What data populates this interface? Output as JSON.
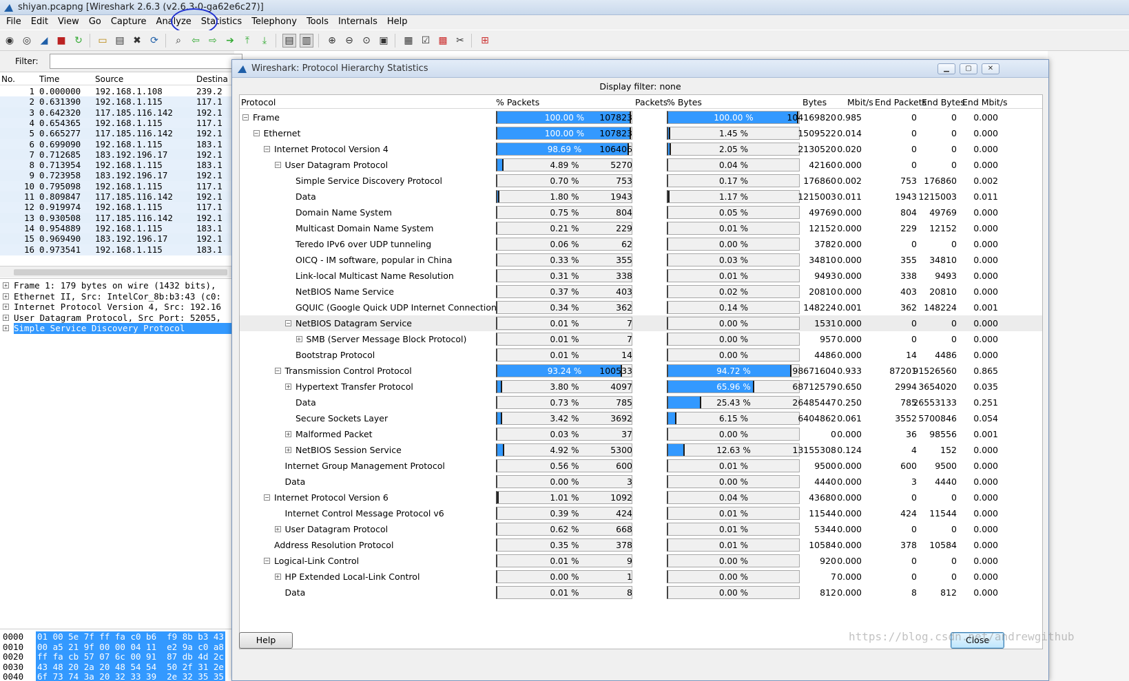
{
  "window": {
    "title": "shiyan.pcapng [Wireshark 2.6.3 (v2.6.3-0-ga62e6c27)]"
  },
  "menu": [
    "File",
    "Edit",
    "View",
    "Go",
    "Capture",
    "Analyze",
    "Statistics",
    "Telephony",
    "Tools",
    "Internals",
    "Help"
  ],
  "filter": {
    "label": "Filter:",
    "value": ""
  },
  "packet_list": {
    "columns": [
      "No.",
      "Time",
      "Source",
      "Destina"
    ],
    "rows": [
      [
        "1",
        "0.000000",
        "192.168.1.108",
        "239.2"
      ],
      [
        "2",
        "0.631390",
        "192.168.1.115",
        "117.1"
      ],
      [
        "3",
        "0.642320",
        "117.185.116.142",
        "192.1"
      ],
      [
        "4",
        "0.654365",
        "192.168.1.115",
        "117.1"
      ],
      [
        "5",
        "0.665277",
        "117.185.116.142",
        "192.1"
      ],
      [
        "6",
        "0.699090",
        "192.168.1.115",
        "183.1"
      ],
      [
        "7",
        "0.712685",
        "183.192.196.17",
        "192.1"
      ],
      [
        "8",
        "0.713954",
        "192.168.1.115",
        "183.1"
      ],
      [
        "9",
        "0.723958",
        "183.192.196.17",
        "192.1"
      ],
      [
        "10",
        "0.795098",
        "192.168.1.115",
        "117.1"
      ],
      [
        "11",
        "0.809847",
        "117.185.116.142",
        "192.1"
      ],
      [
        "12",
        "0.919974",
        "192.168.1.115",
        "117.1"
      ],
      [
        "13",
        "0.930508",
        "117.185.116.142",
        "192.1"
      ],
      [
        "14",
        "0.954889",
        "192.168.1.115",
        "183.1"
      ],
      [
        "15",
        "0.969490",
        "183.192.196.17",
        "192.1"
      ],
      [
        "16",
        "0.973541",
        "192.168.1.115",
        "183.1"
      ]
    ]
  },
  "details": [
    "Frame 1: 179 bytes on wire (1432 bits),",
    "Ethernet II, Src: IntelCor_8b:b3:43 (c0:",
    "Internet Protocol Version 4, Src: 192.16",
    "User Datagram Protocol, Src Port: 52055,",
    "Simple Service Discovery Protocol"
  ],
  "hex": [
    {
      "offset": "0000",
      "bytes": "01 00 5e 7f ff fa c0 b6  f9 8b b3 43"
    },
    {
      "offset": "0010",
      "bytes": "00 a5 21 9f 00 00 04 11  e2 9a c0 a8"
    },
    {
      "offset": "0020",
      "bytes": "ff fa cb 57 07 6c 00 91  87 db 4d 2c"
    },
    {
      "offset": "0030",
      "bytes": "43 48 20 2a 20 48 54 54  50 2f 31 2e"
    },
    {
      "offset": "0040",
      "bytes": "6f 73 74 3a 20 32 33 39  2e 32 35 35"
    }
  ],
  "dialog": {
    "title": "Wireshark: Protocol Hierarchy Statistics",
    "display_filter": "Display filter: none",
    "columns": [
      "Protocol",
      "% Packets",
      "Packets",
      "% Bytes",
      "Bytes",
      "Mbit/s",
      "End Packets",
      "End Bytes",
      "End Mbit/s"
    ],
    "help_label": "Help",
    "close_label": "Close",
    "rows": [
      {
        "name": "Frame",
        "level": 0,
        "exp": "minus",
        "pkt_pct": 100.0,
        "pkt_pct_label": "100.00 %",
        "packets": "107823",
        "byte_pct": 100.0,
        "byte_pct_label": "100.00 %",
        "bytes": "104169820",
        "mbit": "0.985",
        "end_packets": "0",
        "end_bytes": "0",
        "end_mbit": "0.000"
      },
      {
        "name": "Ethernet",
        "level": 1,
        "exp": "minus",
        "pkt_pct": 100.0,
        "pkt_pct_label": "100.00 %",
        "packets": "107823",
        "byte_pct": 1.45,
        "byte_pct_label": "1.45 %",
        "bytes": "1509522",
        "mbit": "0.014",
        "end_packets": "0",
        "end_bytes": "0",
        "end_mbit": "0.000"
      },
      {
        "name": "Internet Protocol Version 4",
        "level": 2,
        "exp": "minus",
        "pkt_pct": 98.69,
        "pkt_pct_label": "98.69 %",
        "packets": "106406",
        "byte_pct": 2.05,
        "byte_pct_label": "2.05 %",
        "bytes": "2130520",
        "mbit": "0.020",
        "end_packets": "0",
        "end_bytes": "0",
        "end_mbit": "0.000"
      },
      {
        "name": "User Datagram Protocol",
        "level": 3,
        "exp": "minus",
        "pkt_pct": 4.89,
        "pkt_pct_label": "4.89 %",
        "packets": "5270",
        "byte_pct": 0.04,
        "byte_pct_label": "0.04 %",
        "bytes": "42160",
        "mbit": "0.000",
        "end_packets": "0",
        "end_bytes": "0",
        "end_mbit": "0.000"
      },
      {
        "name": "Simple Service Discovery Protocol",
        "level": 4,
        "exp": "",
        "pkt_pct": 0.7,
        "pkt_pct_label": "0.70 %",
        "packets": "753",
        "byte_pct": 0.17,
        "byte_pct_label": "0.17 %",
        "bytes": "176860",
        "mbit": "0.002",
        "end_packets": "753",
        "end_bytes": "176860",
        "end_mbit": "0.002"
      },
      {
        "name": "Data",
        "level": 4,
        "exp": "",
        "pkt_pct": 1.8,
        "pkt_pct_label": "1.80 %",
        "packets": "1943",
        "byte_pct": 1.17,
        "byte_pct_label": "1.17 %",
        "bytes": "1215003",
        "mbit": "0.011",
        "end_packets": "1943",
        "end_bytes": "1215003",
        "end_mbit": "0.011"
      },
      {
        "name": "Domain Name System",
        "level": 4,
        "exp": "",
        "pkt_pct": 0.75,
        "pkt_pct_label": "0.75 %",
        "packets": "804",
        "byte_pct": 0.05,
        "byte_pct_label": "0.05 %",
        "bytes": "49769",
        "mbit": "0.000",
        "end_packets": "804",
        "end_bytes": "49769",
        "end_mbit": "0.000"
      },
      {
        "name": "Multicast Domain Name System",
        "level": 4,
        "exp": "",
        "pkt_pct": 0.21,
        "pkt_pct_label": "0.21 %",
        "packets": "229",
        "byte_pct": 0.01,
        "byte_pct_label": "0.01 %",
        "bytes": "12152",
        "mbit": "0.000",
        "end_packets": "229",
        "end_bytes": "12152",
        "end_mbit": "0.000"
      },
      {
        "name": "Teredo IPv6 over UDP tunneling",
        "level": 4,
        "exp": "",
        "pkt_pct": 0.06,
        "pkt_pct_label": "0.06 %",
        "packets": "62",
        "byte_pct": 0.0,
        "byte_pct_label": "0.00 %",
        "bytes": "3782",
        "mbit": "0.000",
        "end_packets": "0",
        "end_bytes": "0",
        "end_mbit": "0.000"
      },
      {
        "name": "OICQ - IM software, popular in China",
        "level": 4,
        "exp": "",
        "pkt_pct": 0.33,
        "pkt_pct_label": "0.33 %",
        "packets": "355",
        "byte_pct": 0.03,
        "byte_pct_label": "0.03 %",
        "bytes": "34810",
        "mbit": "0.000",
        "end_packets": "355",
        "end_bytes": "34810",
        "end_mbit": "0.000"
      },
      {
        "name": "Link-local Multicast Name Resolution",
        "level": 4,
        "exp": "",
        "pkt_pct": 0.31,
        "pkt_pct_label": "0.31 %",
        "packets": "338",
        "byte_pct": 0.01,
        "byte_pct_label": "0.01 %",
        "bytes": "9493",
        "mbit": "0.000",
        "end_packets": "338",
        "end_bytes": "9493",
        "end_mbit": "0.000"
      },
      {
        "name": "NetBIOS Name Service",
        "level": 4,
        "exp": "",
        "pkt_pct": 0.37,
        "pkt_pct_label": "0.37 %",
        "packets": "403",
        "byte_pct": 0.02,
        "byte_pct_label": "0.02 %",
        "bytes": "20810",
        "mbit": "0.000",
        "end_packets": "403",
        "end_bytes": "20810",
        "end_mbit": "0.000"
      },
      {
        "name": "GQUIC (Google Quick UDP Internet Connections)",
        "level": 4,
        "exp": "",
        "pkt_pct": 0.34,
        "pkt_pct_label": "0.34 %",
        "packets": "362",
        "byte_pct": 0.14,
        "byte_pct_label": "0.14 %",
        "bytes": "148224",
        "mbit": "0.001",
        "end_packets": "362",
        "end_bytes": "148224",
        "end_mbit": "0.001"
      },
      {
        "name": "NetBIOS Datagram Service",
        "level": 4,
        "exp": "minus",
        "highlight": true,
        "pkt_pct": 0.01,
        "pkt_pct_label": "0.01 %",
        "packets": "7",
        "byte_pct": 0.0,
        "byte_pct_label": "0.00 %",
        "bytes": "1531",
        "mbit": "0.000",
        "end_packets": "0",
        "end_bytes": "0",
        "end_mbit": "0.000"
      },
      {
        "name": "SMB (Server Message Block Protocol)",
        "level": 5,
        "exp": "plus",
        "pkt_pct": 0.01,
        "pkt_pct_label": "0.01 %",
        "packets": "7",
        "byte_pct": 0.0,
        "byte_pct_label": "0.00 %",
        "bytes": "957",
        "mbit": "0.000",
        "end_packets": "0",
        "end_bytes": "0",
        "end_mbit": "0.000"
      },
      {
        "name": "Bootstrap Protocol",
        "level": 4,
        "exp": "",
        "pkt_pct": 0.01,
        "pkt_pct_label": "0.01 %",
        "packets": "14",
        "byte_pct": 0.0,
        "byte_pct_label": "0.00 %",
        "bytes": "4486",
        "mbit": "0.000",
        "end_packets": "14",
        "end_bytes": "4486",
        "end_mbit": "0.000"
      },
      {
        "name": "Transmission Control Protocol",
        "level": 3,
        "exp": "minus",
        "pkt_pct": 93.24,
        "pkt_pct_label": "93.24 %",
        "packets": "100533",
        "byte_pct": 94.72,
        "byte_pct_label": "94.72 %",
        "bytes": "98671604",
        "mbit": "0.933",
        "end_packets": "87201",
        "end_bytes": "91526560",
        "end_mbit": "0.865"
      },
      {
        "name": "Hypertext Transfer Protocol",
        "level": 4,
        "exp": "plus",
        "pkt_pct": 3.8,
        "pkt_pct_label": "3.80 %",
        "packets": "4097",
        "byte_pct": 65.96,
        "byte_pct_label": "65.96 %",
        "bytes": "68712579",
        "mbit": "0.650",
        "end_packets": "2994",
        "end_bytes": "3654020",
        "end_mbit": "0.035"
      },
      {
        "name": "Data",
        "level": 4,
        "exp": "",
        "pkt_pct": 0.73,
        "pkt_pct_label": "0.73 %",
        "packets": "785",
        "byte_pct": 25.43,
        "byte_pct_label": "25.43 %",
        "bytes": "26485447",
        "mbit": "0.250",
        "end_packets": "785",
        "end_bytes": "26553133",
        "end_mbit": "0.251"
      },
      {
        "name": "Secure Sockets Layer",
        "level": 4,
        "exp": "",
        "pkt_pct": 3.42,
        "pkt_pct_label": "3.42 %",
        "packets": "3692",
        "byte_pct": 6.15,
        "byte_pct_label": "6.15 %",
        "bytes": "6404862",
        "mbit": "0.061",
        "end_packets": "3552",
        "end_bytes": "5700846",
        "end_mbit": "0.054"
      },
      {
        "name": "Malformed Packet",
        "level": 4,
        "exp": "plus",
        "pkt_pct": 0.03,
        "pkt_pct_label": "0.03 %",
        "packets": "37",
        "byte_pct": 0.0,
        "byte_pct_label": "0.00 %",
        "bytes": "0",
        "mbit": "0.000",
        "end_packets": "36",
        "end_bytes": "98556",
        "end_mbit": "0.001"
      },
      {
        "name": "NetBIOS Session Service",
        "level": 4,
        "exp": "plus",
        "pkt_pct": 4.92,
        "pkt_pct_label": "4.92 %",
        "packets": "5300",
        "byte_pct": 12.63,
        "byte_pct_label": "12.63 %",
        "bytes": "13155308",
        "mbit": "0.124",
        "end_packets": "4",
        "end_bytes": "152",
        "end_mbit": "0.000"
      },
      {
        "name": "Internet Group Management Protocol",
        "level": 3,
        "exp": "",
        "pkt_pct": 0.56,
        "pkt_pct_label": "0.56 %",
        "packets": "600",
        "byte_pct": 0.01,
        "byte_pct_label": "0.01 %",
        "bytes": "9500",
        "mbit": "0.000",
        "end_packets": "600",
        "end_bytes": "9500",
        "end_mbit": "0.000"
      },
      {
        "name": "Data",
        "level": 3,
        "exp": "",
        "pkt_pct": 0.0,
        "pkt_pct_label": "0.00 %",
        "packets": "3",
        "byte_pct": 0.0,
        "byte_pct_label": "0.00 %",
        "bytes": "4440",
        "mbit": "0.000",
        "end_packets": "3",
        "end_bytes": "4440",
        "end_mbit": "0.000"
      },
      {
        "name": "Internet Protocol Version 6",
        "level": 2,
        "exp": "minus",
        "pkt_pct": 1.01,
        "pkt_pct_label": "1.01 %",
        "packets": "1092",
        "byte_pct": 0.04,
        "byte_pct_label": "0.04 %",
        "bytes": "43680",
        "mbit": "0.000",
        "end_packets": "0",
        "end_bytes": "0",
        "end_mbit": "0.000"
      },
      {
        "name": "Internet Control Message Protocol v6",
        "level": 3,
        "exp": "",
        "pkt_pct": 0.39,
        "pkt_pct_label": "0.39 %",
        "packets": "424",
        "byte_pct": 0.01,
        "byte_pct_label": "0.01 %",
        "bytes": "11544",
        "mbit": "0.000",
        "end_packets": "424",
        "end_bytes": "11544",
        "end_mbit": "0.000"
      },
      {
        "name": "User Datagram Protocol",
        "level": 3,
        "exp": "plus",
        "pkt_pct": 0.62,
        "pkt_pct_label": "0.62 %",
        "packets": "668",
        "byte_pct": 0.01,
        "byte_pct_label": "0.01 %",
        "bytes": "5344",
        "mbit": "0.000",
        "end_packets": "0",
        "end_bytes": "0",
        "end_mbit": "0.000"
      },
      {
        "name": "Address Resolution Protocol",
        "level": 2,
        "exp": "",
        "pkt_pct": 0.35,
        "pkt_pct_label": "0.35 %",
        "packets": "378",
        "byte_pct": 0.01,
        "byte_pct_label": "0.01 %",
        "bytes": "10584",
        "mbit": "0.000",
        "end_packets": "378",
        "end_bytes": "10584",
        "end_mbit": "0.000"
      },
      {
        "name": "Logical-Link Control",
        "level": 2,
        "exp": "minus",
        "pkt_pct": 0.01,
        "pkt_pct_label": "0.01 %",
        "packets": "9",
        "byte_pct": 0.0,
        "byte_pct_label": "0.00 %",
        "bytes": "920",
        "mbit": "0.000",
        "end_packets": "0",
        "end_bytes": "0",
        "end_mbit": "0.000"
      },
      {
        "name": "HP Extended Local-Link Control",
        "level": 3,
        "exp": "plus",
        "pkt_pct": 0.0,
        "pkt_pct_label": "0.00 %",
        "packets": "1",
        "byte_pct": 0.0,
        "byte_pct_label": "0.00 %",
        "bytes": "7",
        "mbit": "0.000",
        "end_packets": "0",
        "end_bytes": "0",
        "end_mbit": "0.000"
      },
      {
        "name": "Data",
        "level": 3,
        "exp": "",
        "pkt_pct": 0.01,
        "pkt_pct_label": "0.01 %",
        "packets": "8",
        "byte_pct": 0.0,
        "byte_pct_label": "0.00 %",
        "bytes": "812",
        "mbit": "0.000",
        "end_packets": "8",
        "end_bytes": "812",
        "end_mbit": "0.000"
      }
    ]
  },
  "watermark": "https://blog.csdn.net/andrewgithub",
  "colors": {
    "bar_fill": "#3399ff",
    "selection": "#3399ff",
    "annotation_circle": "#2030d0"
  }
}
